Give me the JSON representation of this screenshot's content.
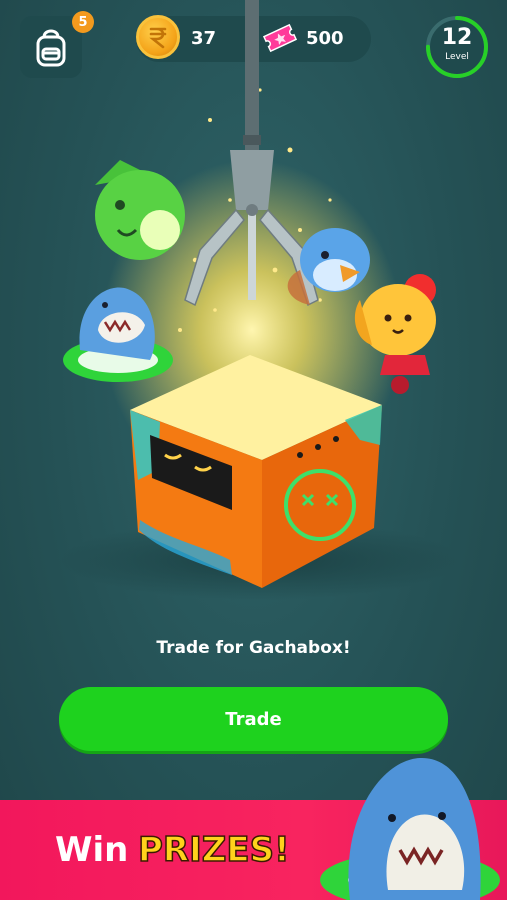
{
  "header": {
    "backpack_badge": "5",
    "coins": "37",
    "tickets": "500",
    "level": {
      "number": "12",
      "label": "Level",
      "progress_fraction": 0.75
    }
  },
  "main": {
    "caption": "Trade for Gachabox!",
    "trade_button_label": "Trade"
  },
  "banner": {
    "win_text": "Win",
    "prizes_text": "PRIZES!"
  },
  "colors": {
    "background": "#255256",
    "trade_button": "#1ed21e",
    "banner": "#f2175c",
    "prizes_text": "#ffd21c",
    "badge": "#f39a1e"
  },
  "icons": [
    "backpack-icon",
    "coin-icon",
    "ticket-icon",
    "claw-icon",
    "gachabox-icon",
    "shark-mascot-icon"
  ]
}
